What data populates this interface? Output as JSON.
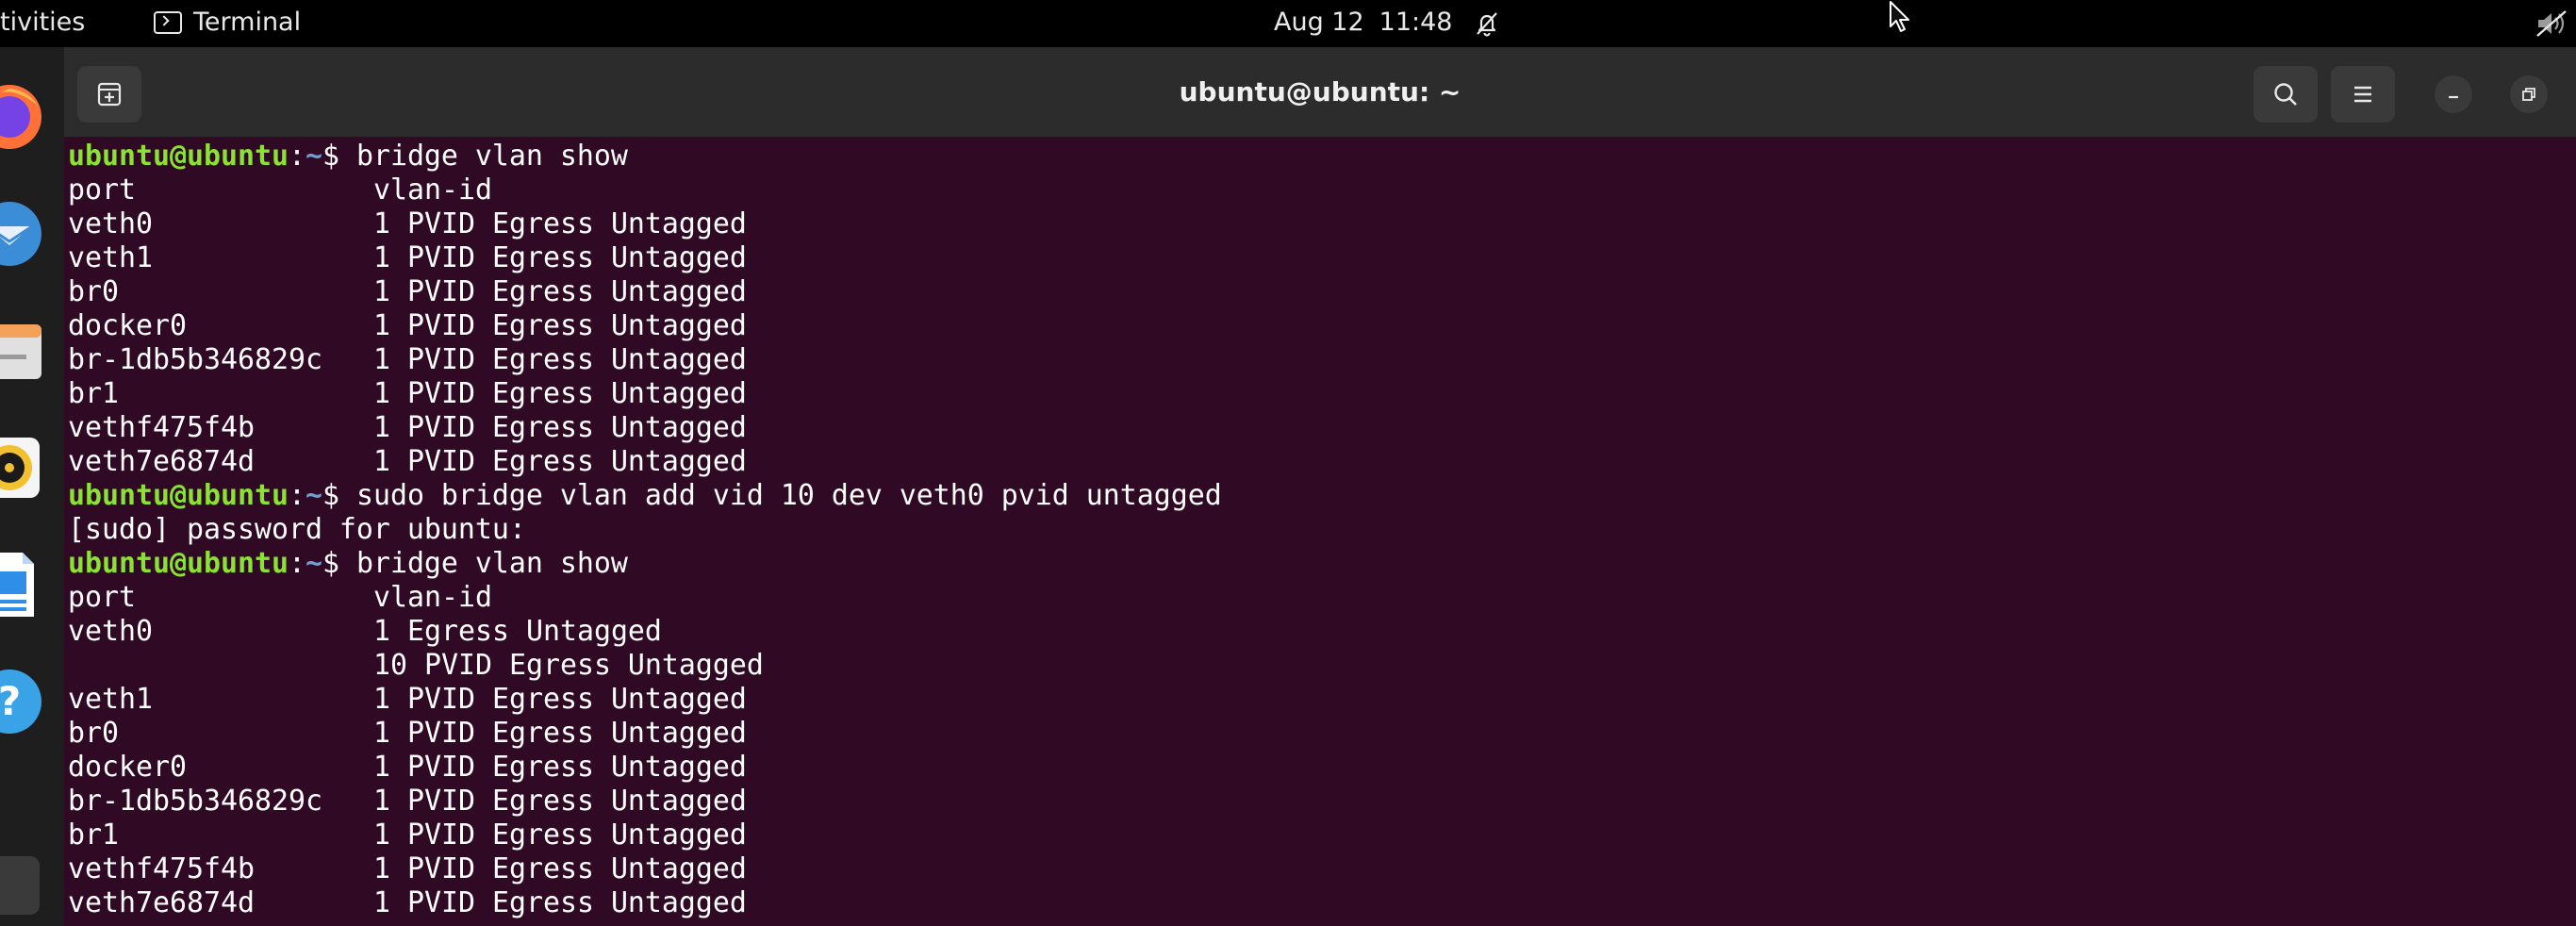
{
  "topbar": {
    "activities": "tivities",
    "app_name": "Terminal",
    "date": "Aug 12",
    "time": "11:48"
  },
  "icons": {
    "terminal_app": "terminal-icon",
    "notifications": "bell-off-icon",
    "sound": "speaker-muted-icon",
    "pointer": "mouse-pointer-icon",
    "new_tab": "new-tab-icon",
    "search": "search-icon",
    "menu": "hamburger-menu-icon",
    "minimize": "minimize-icon",
    "maximize": "maximize-icon"
  },
  "dock": {
    "items": [
      {
        "icon": "firefox-icon",
        "color": "#ff7139"
      },
      {
        "icon": "thunderbird-icon",
        "color": "#3c8dd8"
      },
      {
        "icon": "files-icon",
        "color": "#e8e8e8"
      },
      {
        "icon": "rhythmbox-icon",
        "color": "#f2c132"
      },
      {
        "icon": "libreoffice-writer-icon",
        "color": "#2f8ee8"
      },
      {
        "icon": "help-icon",
        "color": "#3aa3e8"
      },
      {
        "icon": "show-apps-icon",
        "color": "#3a3a3a"
      }
    ]
  },
  "window": {
    "title": "ubuntu@ubuntu: ~"
  },
  "prompt": {
    "user": "ubuntu@ubuntu",
    "sep": ":",
    "path": "~",
    "symbol": "$ "
  },
  "colors": {
    "terminal_bg": "#300a24",
    "prompt_user": "#8ae234",
    "prompt_path": "#729fcf",
    "headerbar": "#2c2c2c"
  },
  "terminal": {
    "lines": [
      {
        "kind": "prompt",
        "cmd": "bridge vlan show"
      },
      {
        "kind": "row",
        "port": "port",
        "vlan": "vlan-id"
      },
      {
        "kind": "row",
        "port": "veth0",
        "vlan": "1 PVID Egress Untagged"
      },
      {
        "kind": "row",
        "port": "veth1",
        "vlan": "1 PVID Egress Untagged"
      },
      {
        "kind": "row",
        "port": "br0",
        "vlan": "1 PVID Egress Untagged"
      },
      {
        "kind": "row",
        "port": "docker0",
        "vlan": "1 PVID Egress Untagged"
      },
      {
        "kind": "row",
        "port": "br-1db5b346829c",
        "vlan": "1 PVID Egress Untagged"
      },
      {
        "kind": "row",
        "port": "br1",
        "vlan": "1 PVID Egress Untagged"
      },
      {
        "kind": "row",
        "port": "vethf475f4b",
        "vlan": "1 PVID Egress Untagged"
      },
      {
        "kind": "row",
        "port": "veth7e6874d",
        "vlan": "1 PVID Egress Untagged"
      },
      {
        "kind": "prompt",
        "cmd": "sudo bridge vlan add vid 10 dev veth0 pvid untagged"
      },
      {
        "kind": "text",
        "text": "[sudo] password for ubuntu:"
      },
      {
        "kind": "prompt",
        "cmd": "bridge vlan show"
      },
      {
        "kind": "row",
        "port": "port",
        "vlan": "vlan-id"
      },
      {
        "kind": "row",
        "port": "veth0",
        "vlan": "1 Egress Untagged"
      },
      {
        "kind": "row",
        "port": "",
        "vlan": "10 PVID Egress Untagged"
      },
      {
        "kind": "row",
        "port": "veth1",
        "vlan": "1 PVID Egress Untagged"
      },
      {
        "kind": "row",
        "port": "br0",
        "vlan": "1 PVID Egress Untagged"
      },
      {
        "kind": "row",
        "port": "docker0",
        "vlan": "1 PVID Egress Untagged"
      },
      {
        "kind": "row",
        "port": "br-1db5b346829c",
        "vlan": "1 PVID Egress Untagged"
      },
      {
        "kind": "row",
        "port": "br1",
        "vlan": "1 PVID Egress Untagged"
      },
      {
        "kind": "row",
        "port": "vethf475f4b",
        "vlan": "1 PVID Egress Untagged"
      },
      {
        "kind": "row",
        "port": "veth7e6874d",
        "vlan": "1 PVID Egress Untagged"
      }
    ]
  }
}
